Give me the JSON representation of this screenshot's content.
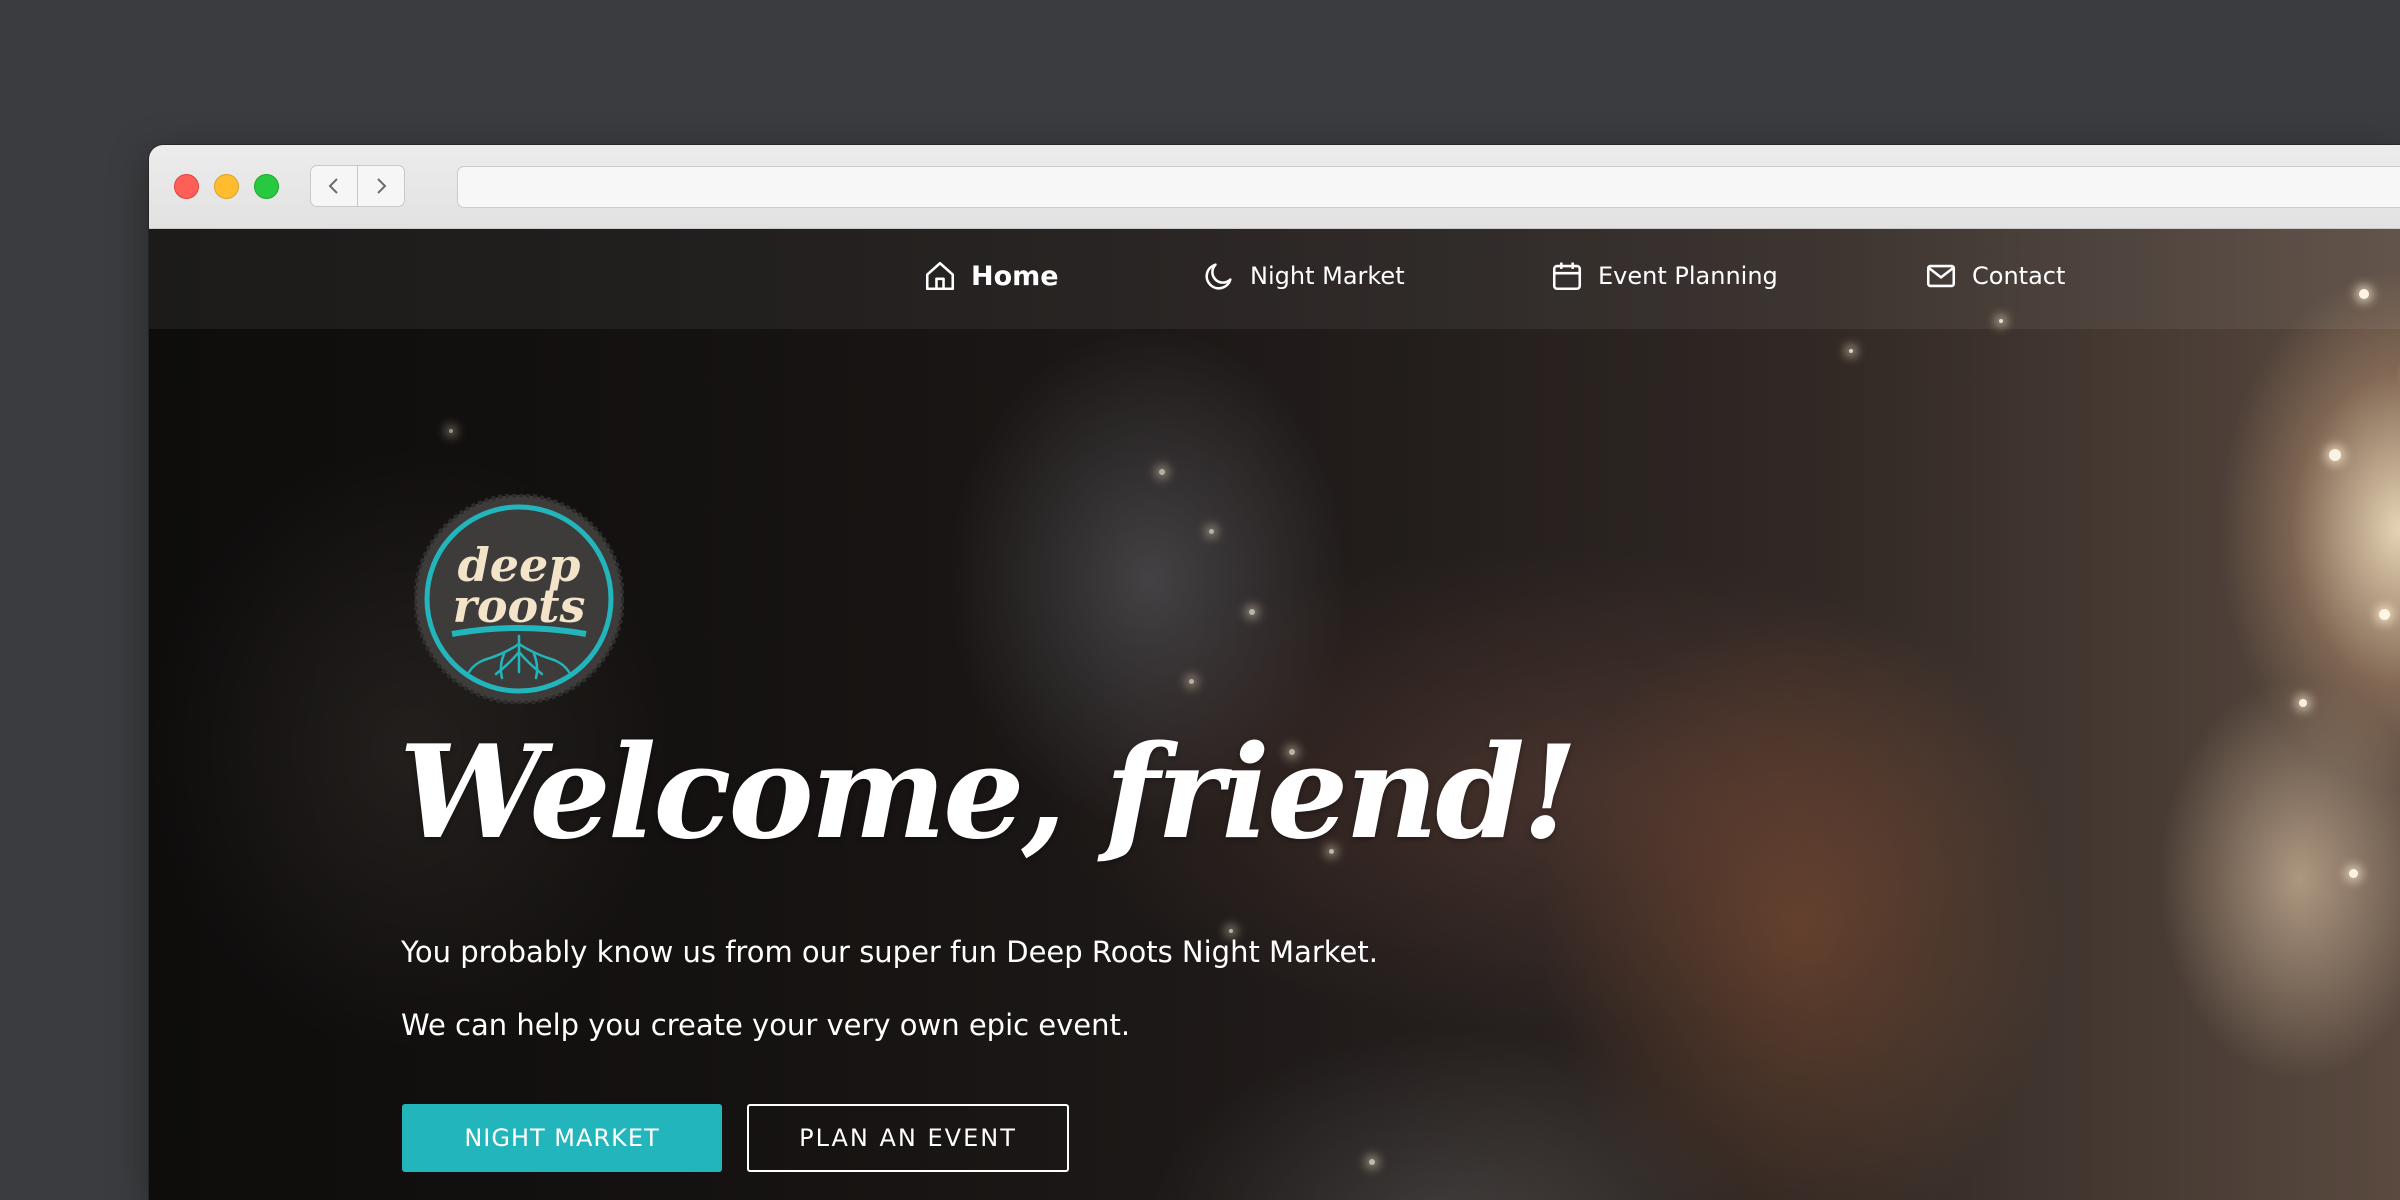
{
  "browser": {
    "back_icon": "chevron-left-icon",
    "forward_icon": "chevron-right-icon",
    "address": ""
  },
  "nav": {
    "items": [
      {
        "label": "Home",
        "icon": "home-icon",
        "active": true
      },
      {
        "label": "Night Market",
        "icon": "moon-icon",
        "active": false
      },
      {
        "label": "Event Planning",
        "icon": "calendar-icon",
        "active": false
      },
      {
        "label": "Contact",
        "icon": "envelope-icon",
        "active": false
      }
    ]
  },
  "logo": {
    "line1": "deep",
    "line2": "roots"
  },
  "hero": {
    "title": "Welcome, friend!",
    "line1": "You probably know us from our super fun Deep Roots Night Market.",
    "line2": "We can help you create your very own epic event.",
    "primary_button": "NIGHT MARKET",
    "secondary_button": "PLAN AN EVENT"
  },
  "colors": {
    "accent": "#23b5bc",
    "logo_cream": "#f3e3c8",
    "logo_dark": "#3d3c3b"
  }
}
